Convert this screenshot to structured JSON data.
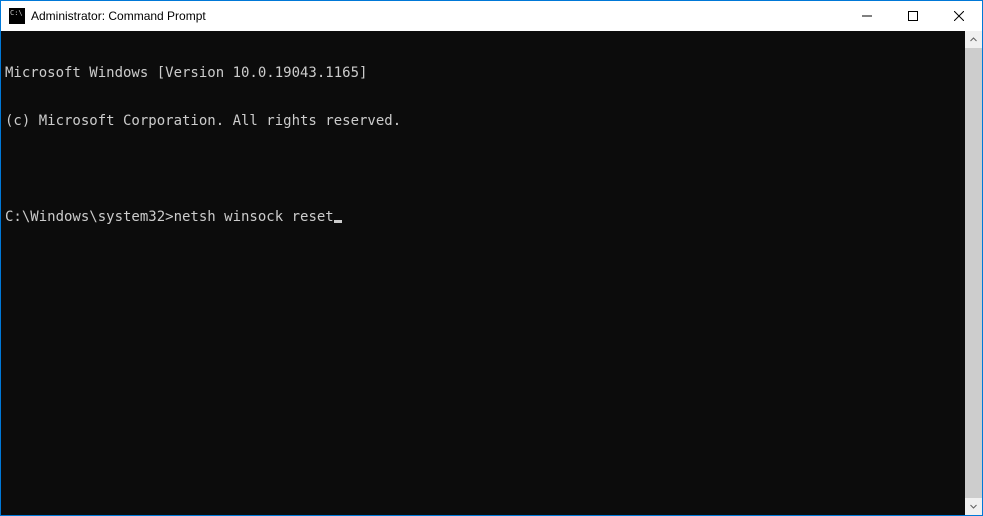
{
  "window": {
    "title": "Administrator: Command Prompt"
  },
  "terminal": {
    "line1": "Microsoft Windows [Version 10.0.19043.1165]",
    "line2": "(c) Microsoft Corporation. All rights reserved.",
    "blank": "",
    "prompt": "C:\\Windows\\system32>",
    "command": "netsh winsock reset"
  }
}
